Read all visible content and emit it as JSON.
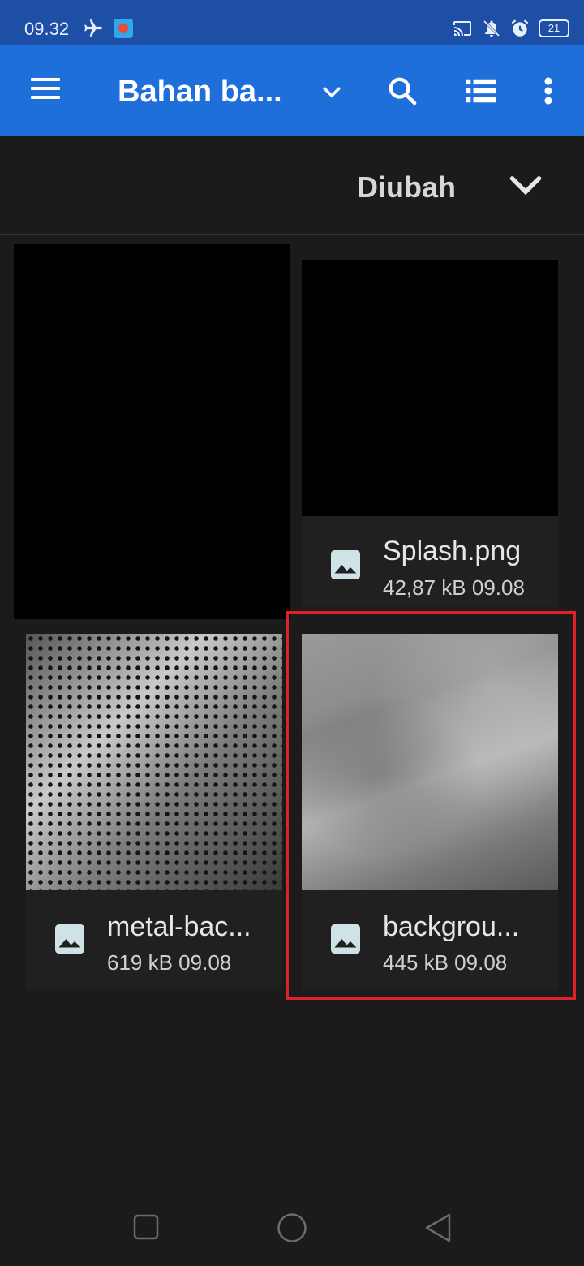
{
  "status_bar": {
    "time": "09.32",
    "battery": "21",
    "icons": [
      "airplane-icon",
      "screen-record-icon",
      "cast-icon",
      "mute-icon",
      "alarm-icon",
      "battery-icon"
    ]
  },
  "app_bar": {
    "title": "Bahan ba...",
    "icons": [
      "menu-icon",
      "chevron-down-icon",
      "search-icon",
      "list-view-icon",
      "more-vert-icon"
    ]
  },
  "sort": {
    "label": "Diubah"
  },
  "files": [
    {
      "name": "Splash.png",
      "meta": "42,87 kB 09.08"
    },
    {
      "name": "metal-bac...",
      "meta": "619 kB 09.08"
    },
    {
      "name": "backgrou...",
      "meta": "445 kB 09.08"
    }
  ],
  "colors": {
    "status_bar": "#1e4fa6",
    "app_bar": "#1e6fd9",
    "background": "#1b1b1b",
    "highlight": "#e0202a"
  },
  "nav_bar": {
    "icons": [
      "recents-icon",
      "home-icon",
      "back-icon"
    ]
  }
}
